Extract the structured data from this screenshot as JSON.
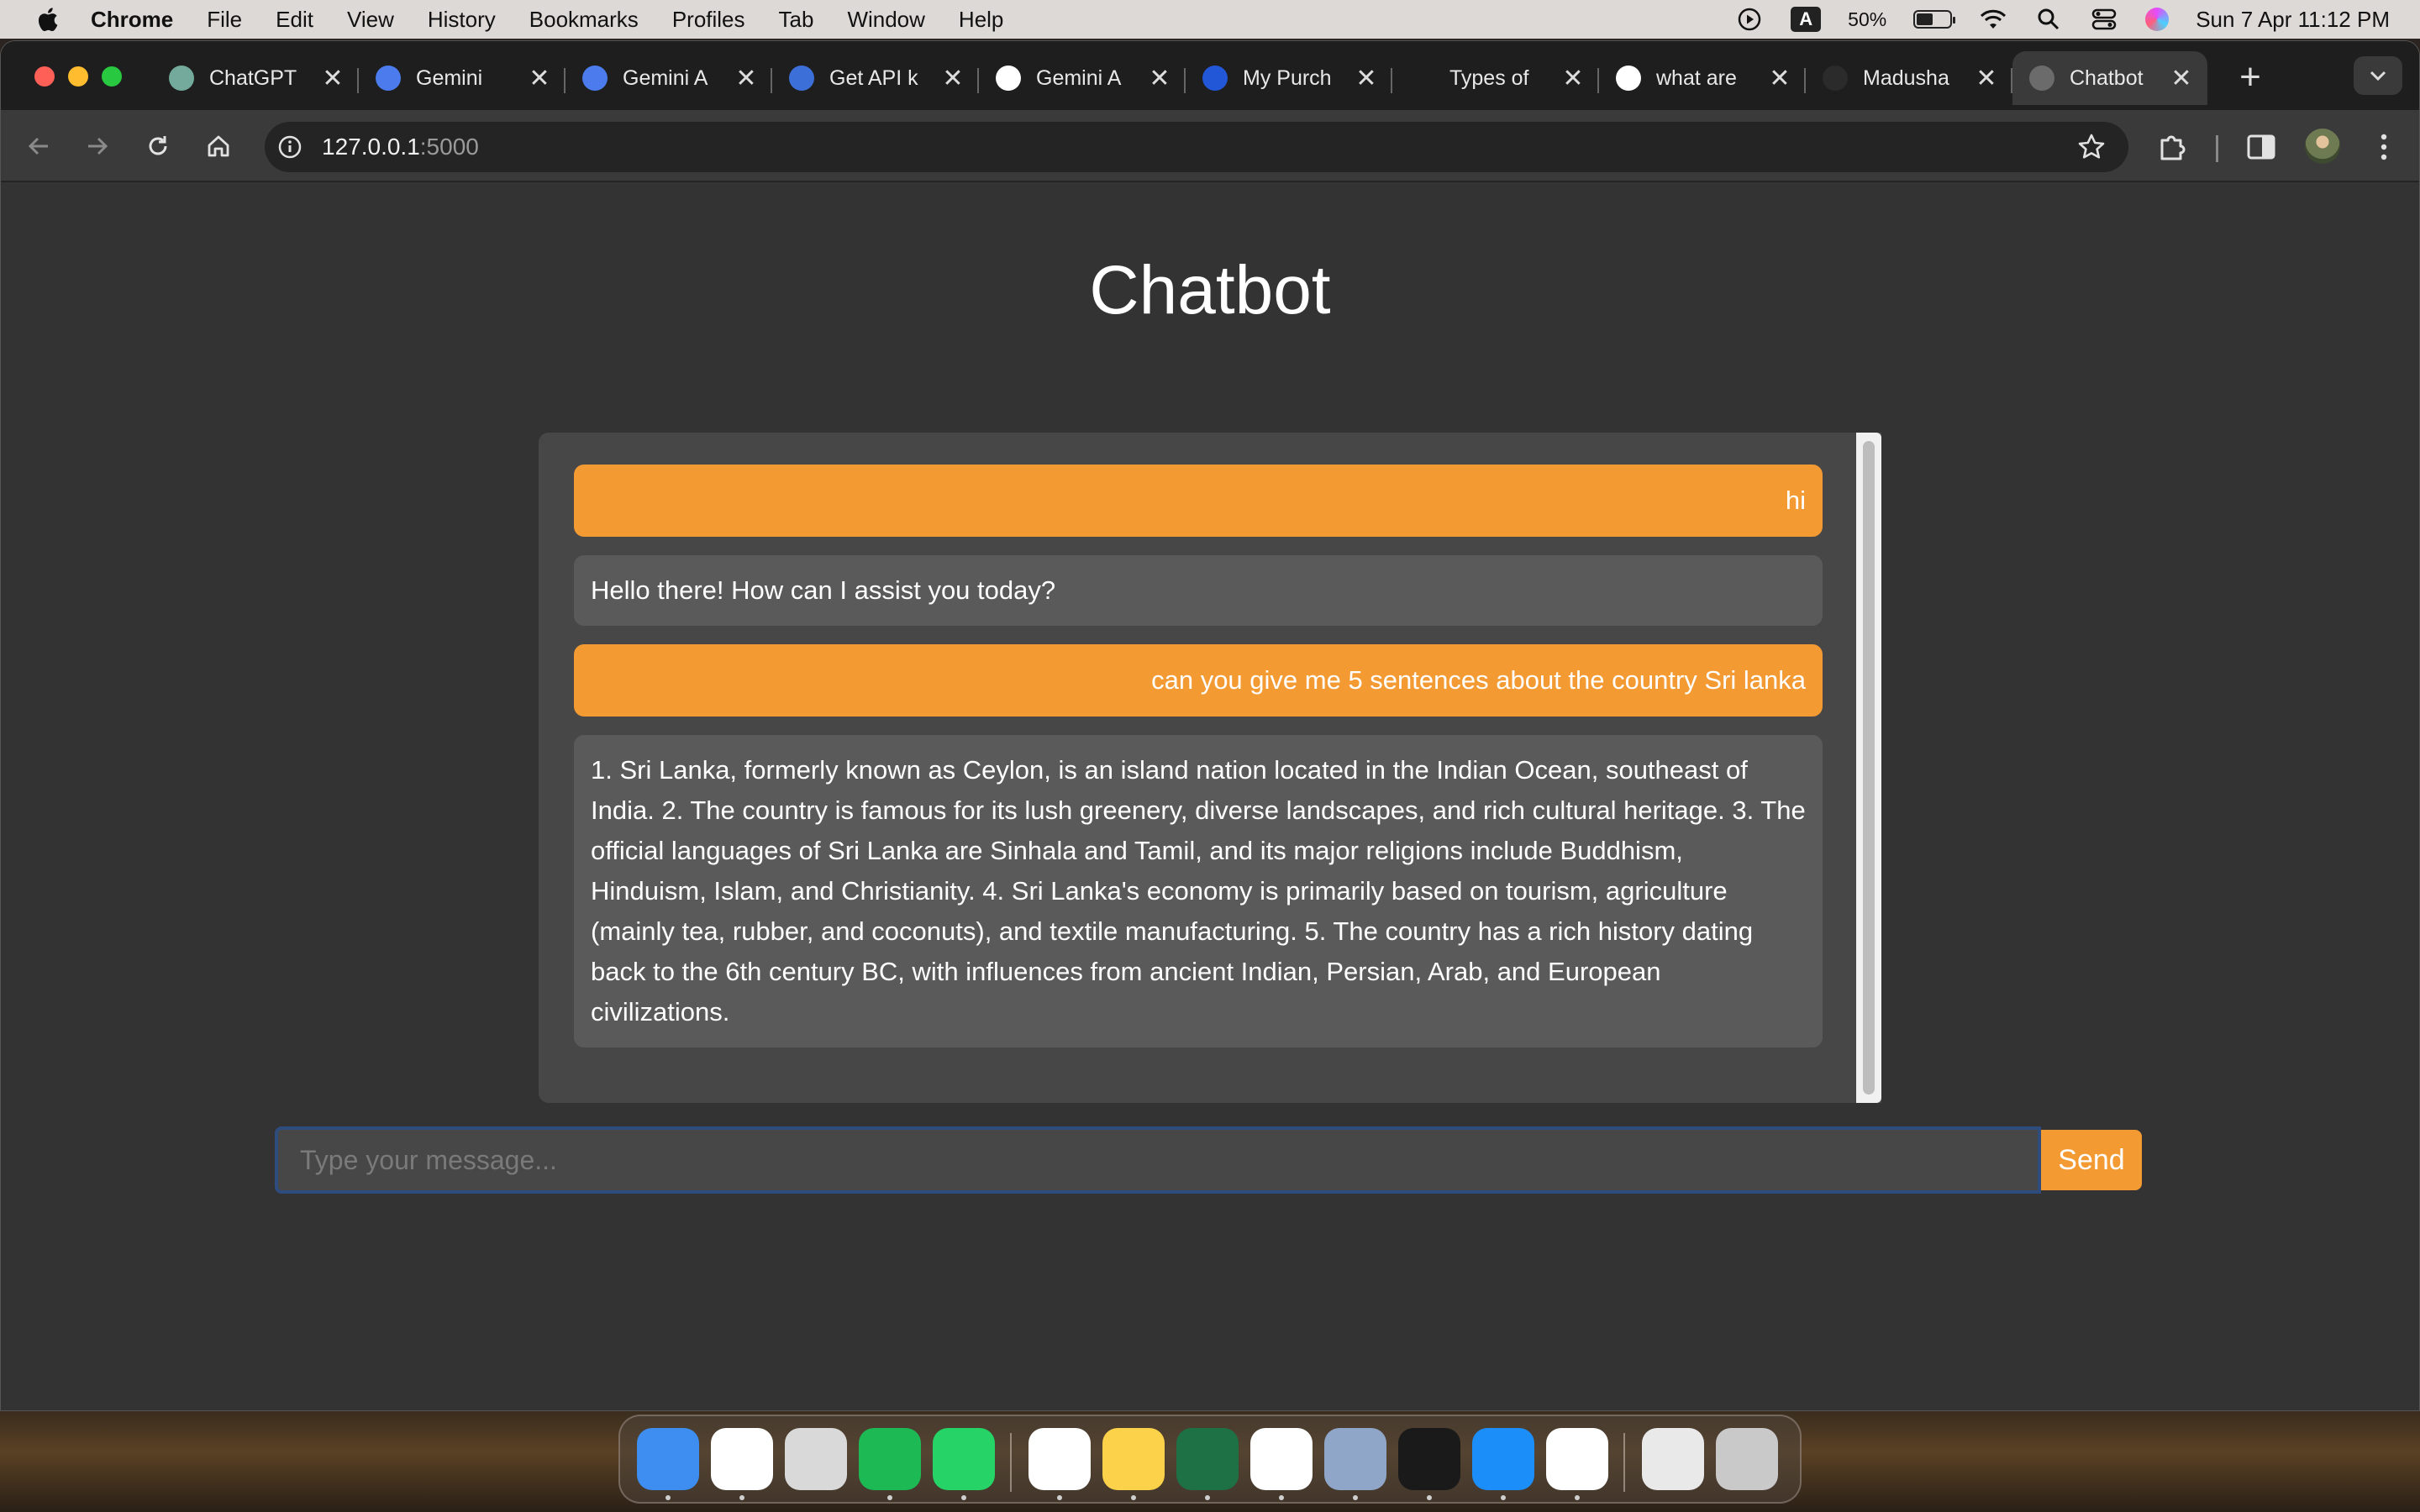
{
  "menubar": {
    "app_name": "Chrome",
    "menus": [
      "File",
      "Edit",
      "View",
      "History",
      "Bookmarks",
      "Profiles",
      "Tab",
      "Window",
      "Help"
    ],
    "input_source": "A",
    "battery": "50%",
    "battery_level": 0.5,
    "datetime": "Sun 7 Apr  11:12 PM"
  },
  "tabs": [
    {
      "title": "ChatGPT",
      "icon": "chatgpt-icon",
      "color": "#74aa9c"
    },
    {
      "title": "Gemini",
      "icon": "gemini-sparkle-icon",
      "color": "#4b7bec"
    },
    {
      "title": "Gemini A",
      "icon": "gemini-sparkle-icon",
      "color": "#4b7bec"
    },
    {
      "title": "Get API k",
      "icon": "ai-studio-icon",
      "color": "#3c6fd8"
    },
    {
      "title": "Gemini A",
      "icon": "google-icon",
      "color": "#ffffff"
    },
    {
      "title": "My Purch",
      "icon": "c-logo-icon",
      "color": "#2257d8"
    },
    {
      "title": "Types of",
      "icon": "dotted-icon",
      "color": "#1e1e1e"
    },
    {
      "title": "what are",
      "icon": "google-icon",
      "color": "#ffffff"
    },
    {
      "title": "Madusha",
      "icon": "github-icon",
      "color": "#2b2b2b"
    },
    {
      "title": "Chatbot",
      "icon": "globe-icon",
      "color": "#6b6b6b",
      "active": true
    }
  ],
  "tab_close_glyph": "✕",
  "newtab_glyph": "+",
  "address": {
    "host": "127.0.0.1",
    "port": ":5000"
  },
  "page": {
    "title": "Chatbot",
    "messages": [
      {
        "role": "user",
        "text": "hi"
      },
      {
        "role": "bot",
        "text": "Hello there! How can I assist you today?"
      },
      {
        "role": "user",
        "text": "can you give me 5 sentences about the country Sri lanka"
      },
      {
        "role": "bot",
        "text": "1. Sri Lanka, formerly known as Ceylon, is an island nation located in the Indian Ocean, southeast of India. 2. The country is famous for its lush greenery, diverse landscapes, and rich cultural heritage. 3. The official languages of Sri Lanka are Sinhala and Tamil, and its major religions include Buddhism, Hinduism, Islam, and Christianity. 4. Sri Lanka's economy is primarily based on tourism, agriculture (mainly tea, rubber, and coconuts), and textile manufacturing. 5. The country has a rich history dating back to the 6th century BC, with influences from ancient Indian, Persian, Arab, and European civilizations."
      }
    ],
    "input_placeholder": "Type your message...",
    "input_value": "",
    "send_label": "Send"
  },
  "colors": {
    "accent": "#f49a33",
    "page_bg": "#333333",
    "chat_bg": "#474747",
    "bot_bubble": "#5a5a5a"
  },
  "dock": {
    "apps": [
      {
        "name": "finder-icon",
        "color": "#3d8ef0",
        "running": true
      },
      {
        "name": "chrome-icon",
        "color": "#ffffff",
        "running": true
      },
      {
        "name": "launchpad-icon",
        "color": "#d9d9d9",
        "running": false
      },
      {
        "name": "spotify-icon",
        "color": "#1db954",
        "running": true
      },
      {
        "name": "whatsapp-icon",
        "color": "#25d366",
        "running": true
      },
      {
        "name": "mongodb-icon",
        "color": "#ffffff",
        "running": true
      },
      {
        "name": "notes-icon",
        "color": "#fbd24a",
        "running": true
      },
      {
        "name": "excel-icon",
        "color": "#1e7145",
        "running": true
      },
      {
        "name": "xmind-icon",
        "color": "#ffffff",
        "running": true
      },
      {
        "name": "preview-icon",
        "color": "#8fa6c8",
        "running": true
      },
      {
        "name": "terminal-icon",
        "color": "#1a1a1a",
        "running": true
      },
      {
        "name": "app-store-icon",
        "color": "#1c8ef9",
        "running": true
      },
      {
        "name": "vscode-icon",
        "color": "#ffffff",
        "running": true
      },
      {
        "name": "downloads-stack-icon",
        "color": "#e9e9e9",
        "running": false
      },
      {
        "name": "trash-icon",
        "color": "#c9c9c9",
        "running": false
      }
    ]
  }
}
